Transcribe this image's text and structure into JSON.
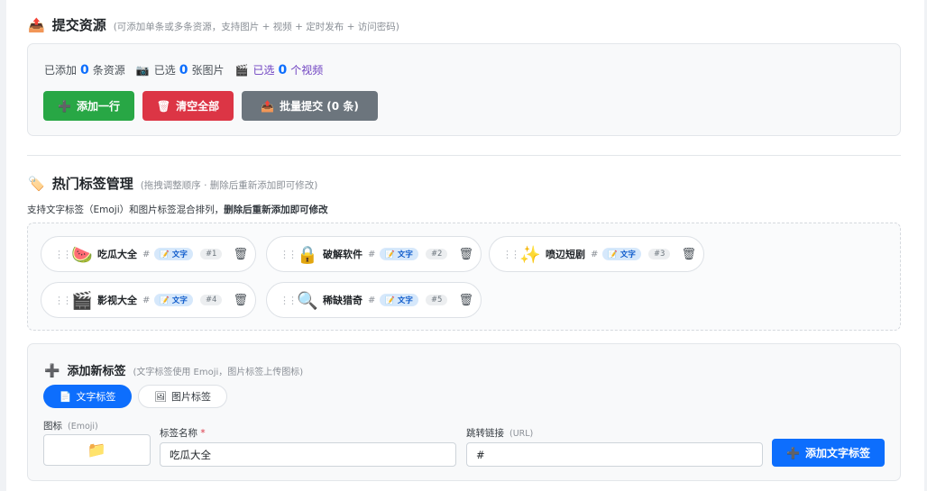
{
  "submit_section": {
    "icon": "📤",
    "title": "提交资源",
    "hint": "(可添加单条或多条资源，支持图片 + 视频 + 定时发布 + 访问密码)",
    "counts": {
      "added_prefix": "已添加",
      "added_num": "0",
      "added_suffix": "条资源",
      "image_icon": "📷",
      "image_prefix": "已选",
      "image_num": "0",
      "image_suffix": "张图片",
      "video_icon": "🎬",
      "video_prefix": "已选",
      "video_num": "0",
      "video_suffix": "个视频"
    },
    "buttons": {
      "add_row": "添加一行",
      "add_row_icon": "➕",
      "clear_all": "清空全部",
      "clear_all_icon": "🗑",
      "batch_submit": "批量提交 (0 条)",
      "batch_submit_icon": "📤"
    }
  },
  "tags_section": {
    "icon": "🏷️",
    "title": "热门标签管理",
    "hint": "(拖拽调整顺序 · 删除后重新添加即可修改)",
    "desc_normal": "支持文字标签（Emoji）和图片标签混合排列，",
    "desc_bold": "删除后重新添加即可修改",
    "tags": [
      {
        "emoji": "🍉",
        "name": "吃瓜大全",
        "hash": "#",
        "type": "📝 文字",
        "index": "#1",
        "trash": "🗑"
      },
      {
        "emoji": "🔒",
        "name": "破解软件",
        "hash": "#",
        "type": "📝 文字",
        "index": "#2",
        "trash": "🗑"
      },
      {
        "emoji": "✨",
        "name": "喷辺短剧",
        "hash": "#",
        "type": "📝 文字",
        "index": "#3",
        "trash": "🗑"
      },
      {
        "emoji": "🎬",
        "name": "影视大全",
        "hash": "#",
        "type": "📝 文字",
        "index": "#4",
        "trash": "🗑"
      },
      {
        "emoji": "🔍",
        "name": "稀缺猎奇",
        "hash": "#",
        "type": "📝 文字",
        "index": "#5",
        "trash": "🗑"
      }
    ]
  },
  "add_tag": {
    "icon": "➕",
    "title": "添加新标签",
    "hint": "(文字标签使用 Emoji，图片标签上传图标)",
    "tabs": [
      {
        "icon": "📄",
        "label": "文字标签"
      },
      {
        "icon": "🖼",
        "label": "图片标签"
      }
    ],
    "icon_label": "图标",
    "icon_sub": "(Emoji)",
    "icon_value": "📁",
    "name_label": "标签名称",
    "name_required": "*",
    "name_value": "吃瓜大全",
    "link_label": "跳转链接",
    "link_sub": "(URL)",
    "link_value": "#",
    "submit_icon": "➕",
    "submit_label": "添加文字标签"
  },
  "colors": {
    "primary": "#0d6efd",
    "success": "#28a745",
    "danger": "#dc3545",
    "secondary": "#6c757d"
  }
}
